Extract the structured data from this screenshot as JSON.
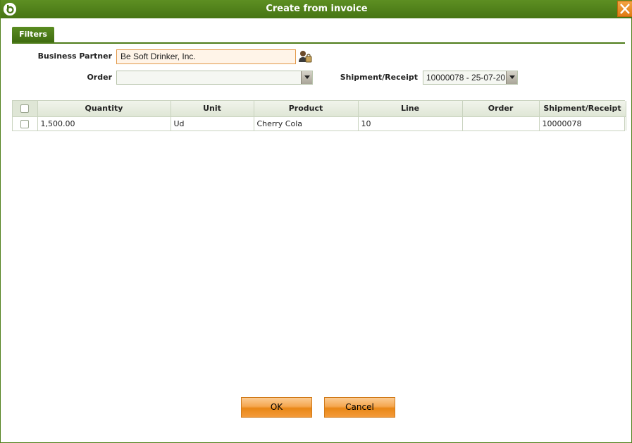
{
  "window": {
    "title": "Create from invoice",
    "logo_icon": "app-logo-icon",
    "close_icon": "close-icon"
  },
  "tabs": [
    {
      "label": "Filters",
      "active": true
    }
  ],
  "filters": {
    "business_partner_label": "Business Partner",
    "business_partner_value": "Be Soft Drinker, Inc.",
    "business_partner_search_icon": "business-partner-search-icon",
    "order_label": "Order",
    "order_value": "",
    "shipment_label": "Shipment/Receipt",
    "shipment_value": "10000078 - 25-07-20"
  },
  "grid": {
    "columns": [
      "Quantity",
      "Unit",
      "Product",
      "Line",
      "Order",
      "Shipment/Receipt"
    ],
    "rows": [
      {
        "quantity": "1,500.00",
        "unit": "Ud",
        "product": "Cherry Cola",
        "line": "10",
        "order": "",
        "shipment": "10000078"
      }
    ]
  },
  "buttons": {
    "ok_label": "OK",
    "cancel_label": "Cancel"
  },
  "colors": {
    "title_bar": "#467514",
    "accent_orange": "#e98716",
    "input_highlight": "#fff4e8"
  }
}
